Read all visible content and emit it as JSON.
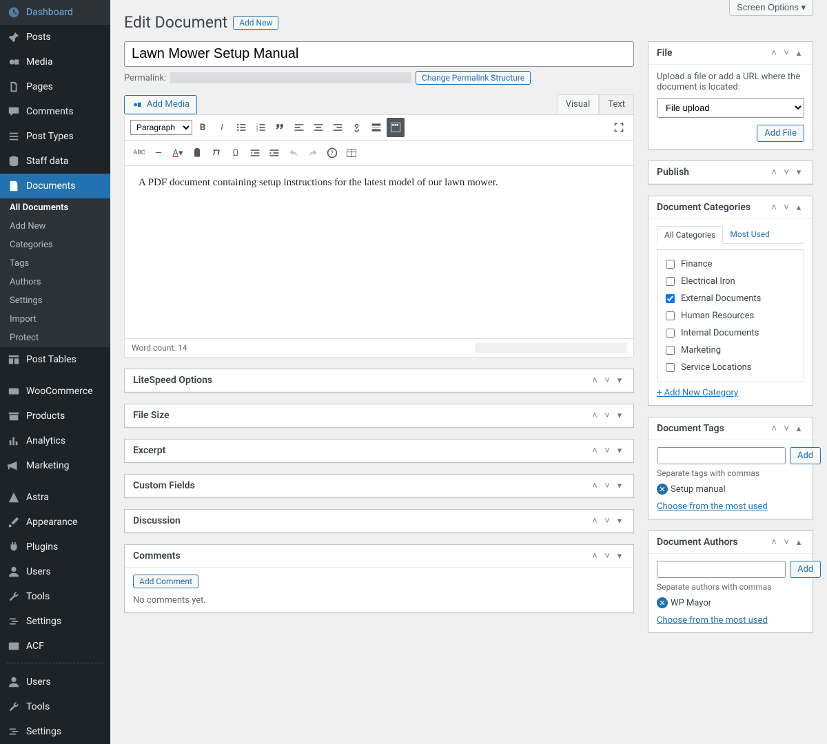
{
  "screen_options": "Screen Options ▾",
  "page_title": "Edit Document",
  "add_new": "Add New",
  "title_value": "Lawn Mower Setup Manual",
  "permalink_label": "Permalink:",
  "change_permalink": "Change Permalink Structure",
  "add_media": "Add Media",
  "tabs": {
    "visual": "Visual",
    "text": "Text"
  },
  "format_select": "Paragraph",
  "content": "A PDF document containing setup instructions for the latest model of our lawn mower.",
  "word_count": "Word count: 14",
  "sidebar_nav": {
    "dashboard": "Dashboard",
    "posts": "Posts",
    "media": "Media",
    "pages": "Pages",
    "comments": "Comments",
    "post_types": "Post Types",
    "staff_data": "Staff data",
    "documents": "Documents",
    "post_tables": "Post Tables",
    "woocommerce": "WooCommerce",
    "products": "Products",
    "analytics": "Analytics",
    "marketing": "Marketing",
    "astra": "Astra",
    "appearance": "Appearance",
    "plugins": "Plugins",
    "users": "Users",
    "tools": "Tools",
    "settings": "Settings",
    "acf": "ACF"
  },
  "doc_submenu": {
    "all": "All Documents",
    "add_new": "Add New",
    "categories": "Categories",
    "tags": "Tags",
    "authors": "Authors",
    "settings": "Settings",
    "import": "Import",
    "protect": "Protect"
  },
  "main_metaboxes": {
    "litespeed": "LiteSpeed Options",
    "file_size": "File Size",
    "excerpt": "Excerpt",
    "custom_fields": "Custom Fields",
    "discussion": "Discussion",
    "comments": "Comments",
    "add_comment": "Add Comment",
    "no_comments": "No comments yet."
  },
  "file_box": {
    "title": "File",
    "help": "Upload a file or add a URL where the document is located:",
    "select_value": "File upload",
    "add_file": "Add File"
  },
  "publish_box": {
    "title": "Publish"
  },
  "categories_box": {
    "title": "Document Categories",
    "tab_all": "All Categories",
    "tab_most": "Most Used",
    "items": [
      {
        "label": "Finance",
        "checked": false
      },
      {
        "label": "Electrical Iron",
        "checked": false
      },
      {
        "label": "External Documents",
        "checked": true
      },
      {
        "label": "Human Resources",
        "checked": false
      },
      {
        "label": "Internal Documents",
        "checked": false
      },
      {
        "label": "Marketing",
        "checked": false
      },
      {
        "label": "Service Locations",
        "checked": false
      }
    ],
    "add_new": "+ Add New Category"
  },
  "tags_box": {
    "title": "Document Tags",
    "add": "Add",
    "help": "Separate tags with commas",
    "existing": "Setup manual",
    "choose": "Choose from the most used"
  },
  "authors_box": {
    "title": "Document Authors",
    "add": "Add",
    "help": "Separate authors with commas",
    "existing": "WP Mayor",
    "choose": "Choose from the most used"
  }
}
